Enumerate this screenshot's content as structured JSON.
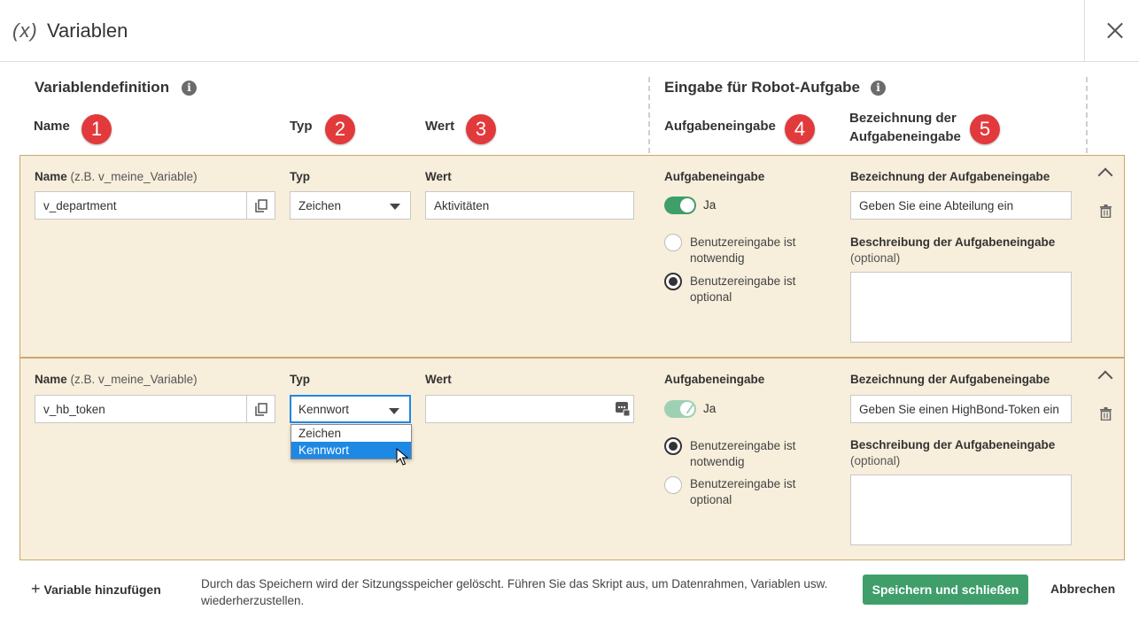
{
  "header": {
    "icon_text": "(x)",
    "icon": "variable-icon",
    "title": "Variablen",
    "close_icon": "close-icon"
  },
  "sections": {
    "definition_title": "Variablendefinition",
    "robot_title": "Eingabe für Robot-Aufgabe",
    "info_icon": "info-icon"
  },
  "columns": {
    "name": "Name",
    "type": "Typ",
    "value": "Wert",
    "task_input": "Aufgabeneingabe",
    "task_input_label_line1": "Bezeichnung der",
    "task_input_label_line2": "Aufgabeneingabe"
  },
  "badges": [
    "1",
    "2",
    "3",
    "4",
    "5"
  ],
  "rows": [
    {
      "name_label": "Name",
      "name_hint": "(z.B. v_meine_Variable)",
      "name_value": "v_department",
      "type_label": "Typ",
      "type_value": "Zeichen",
      "value_label": "Wert",
      "value_value": "Aktivitäten",
      "task_input_label": "Aufgabeneingabe",
      "toggle_label": "Ja",
      "radio_required": "Benutzereingabe ist notwendig",
      "radio_optional": "Benutzereingabe ist optional",
      "selected_radio": "optional",
      "label_heading": "Bezeichnung der Aufgabeneingabe",
      "label_value": "Geben Sie eine Abteilung ein",
      "desc_heading": "Beschreibung der Aufgabeneingabe",
      "desc_hint": "(optional)",
      "desc_value": ""
    },
    {
      "name_label": "Name",
      "name_hint": "(z.B. v_meine_Variable)",
      "name_value": "v_hb_token",
      "type_label": "Typ",
      "type_value": "Kennwort",
      "type_options": [
        "Zeichen",
        "Kennwort"
      ],
      "value_label": "Wert",
      "value_value": "",
      "task_input_label": "Aufgabeneingabe",
      "toggle_label": "Ja",
      "radio_required": "Benutzereingabe ist notwendig",
      "radio_optional": "Benutzereingabe ist optional",
      "selected_radio": "required",
      "label_heading": "Bezeichnung der Aufgabeneingabe",
      "label_value": "Geben Sie einen HighBond-Token ein",
      "desc_heading": "Beschreibung der Aufgabeneingabe",
      "desc_hint": "(optional)",
      "desc_value": ""
    }
  ],
  "footer": {
    "add_variable": "Variable hinzufügen",
    "note": "Durch das Speichern wird der Sitzungsspeicher gelöscht. Führen Sie das Skript aus, um Datenrahmen, Variablen usw. wiederherzustellen.",
    "save": "Speichern und schließen",
    "cancel": "Abbrechen"
  },
  "colors": {
    "row_bg": "#f7eedb",
    "row_border": "#c9a96b",
    "badge": "#e23a3c",
    "accent_green": "#3f9e6a",
    "highlight_blue": "#1e88e5"
  }
}
